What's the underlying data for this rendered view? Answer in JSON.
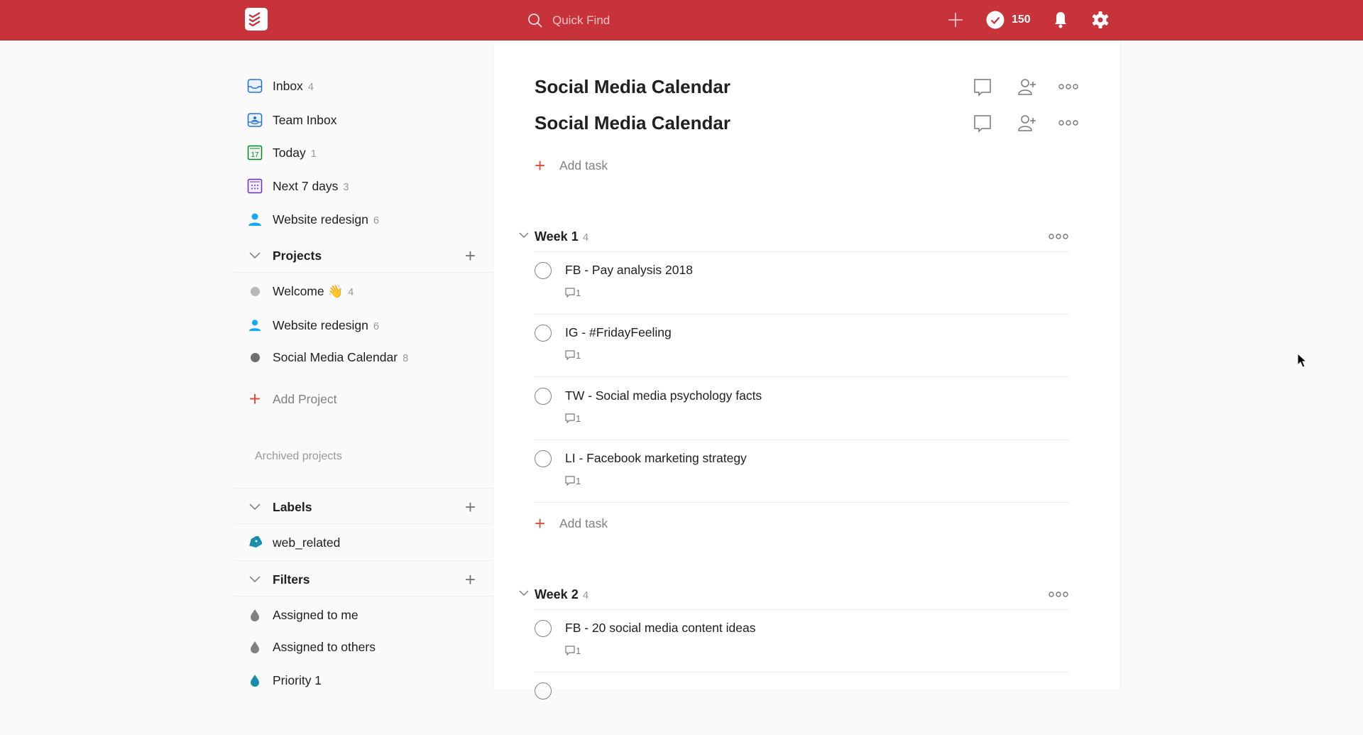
{
  "topbar": {
    "search_placeholder": "Quick Find",
    "karma": "150",
    "brand_color": "#c8323b"
  },
  "sidebar": {
    "nav": [
      {
        "label": "Inbox",
        "count": "4"
      },
      {
        "label": "Team Inbox",
        "count": ""
      },
      {
        "label": "Today",
        "count": "1"
      },
      {
        "label": "Next 7 days",
        "count": "3"
      },
      {
        "label": "Website redesign",
        "count": "6"
      }
    ],
    "projects_label": "Projects",
    "projects": [
      {
        "label": "Welcome 👋",
        "count": "4"
      },
      {
        "label": "Website redesign",
        "count": "6"
      },
      {
        "label": "Social Media Calendar",
        "count": "8"
      }
    ],
    "add_project": "Add Project",
    "archived": "Archived projects",
    "labels_label": "Labels",
    "labels": [
      {
        "label": "web_related"
      }
    ],
    "filters_label": "Filters",
    "filters": [
      {
        "label": "Assigned to me"
      },
      {
        "label": "Assigned to others"
      },
      {
        "label": "Priority 1"
      }
    ]
  },
  "main": {
    "titles": [
      "Social Media Calendar",
      "Social Media Calendar"
    ],
    "add_task": "Add task",
    "sections": [
      {
        "name": "Week 1",
        "count": "4",
        "tasks": [
          {
            "title": "FB - Pay analysis 2018",
            "comments": "1"
          },
          {
            "title": "IG - #FridayFeeling",
            "comments": "1"
          },
          {
            "title": "TW - Social media psychology facts",
            "comments": "1"
          },
          {
            "title": "LI - Facebook marketing strategy",
            "comments": "1"
          }
        ]
      },
      {
        "name": "Week 2",
        "count": "4",
        "tasks": [
          {
            "title": "FB - 20 social media content ideas",
            "comments": "1"
          }
        ]
      }
    ]
  }
}
